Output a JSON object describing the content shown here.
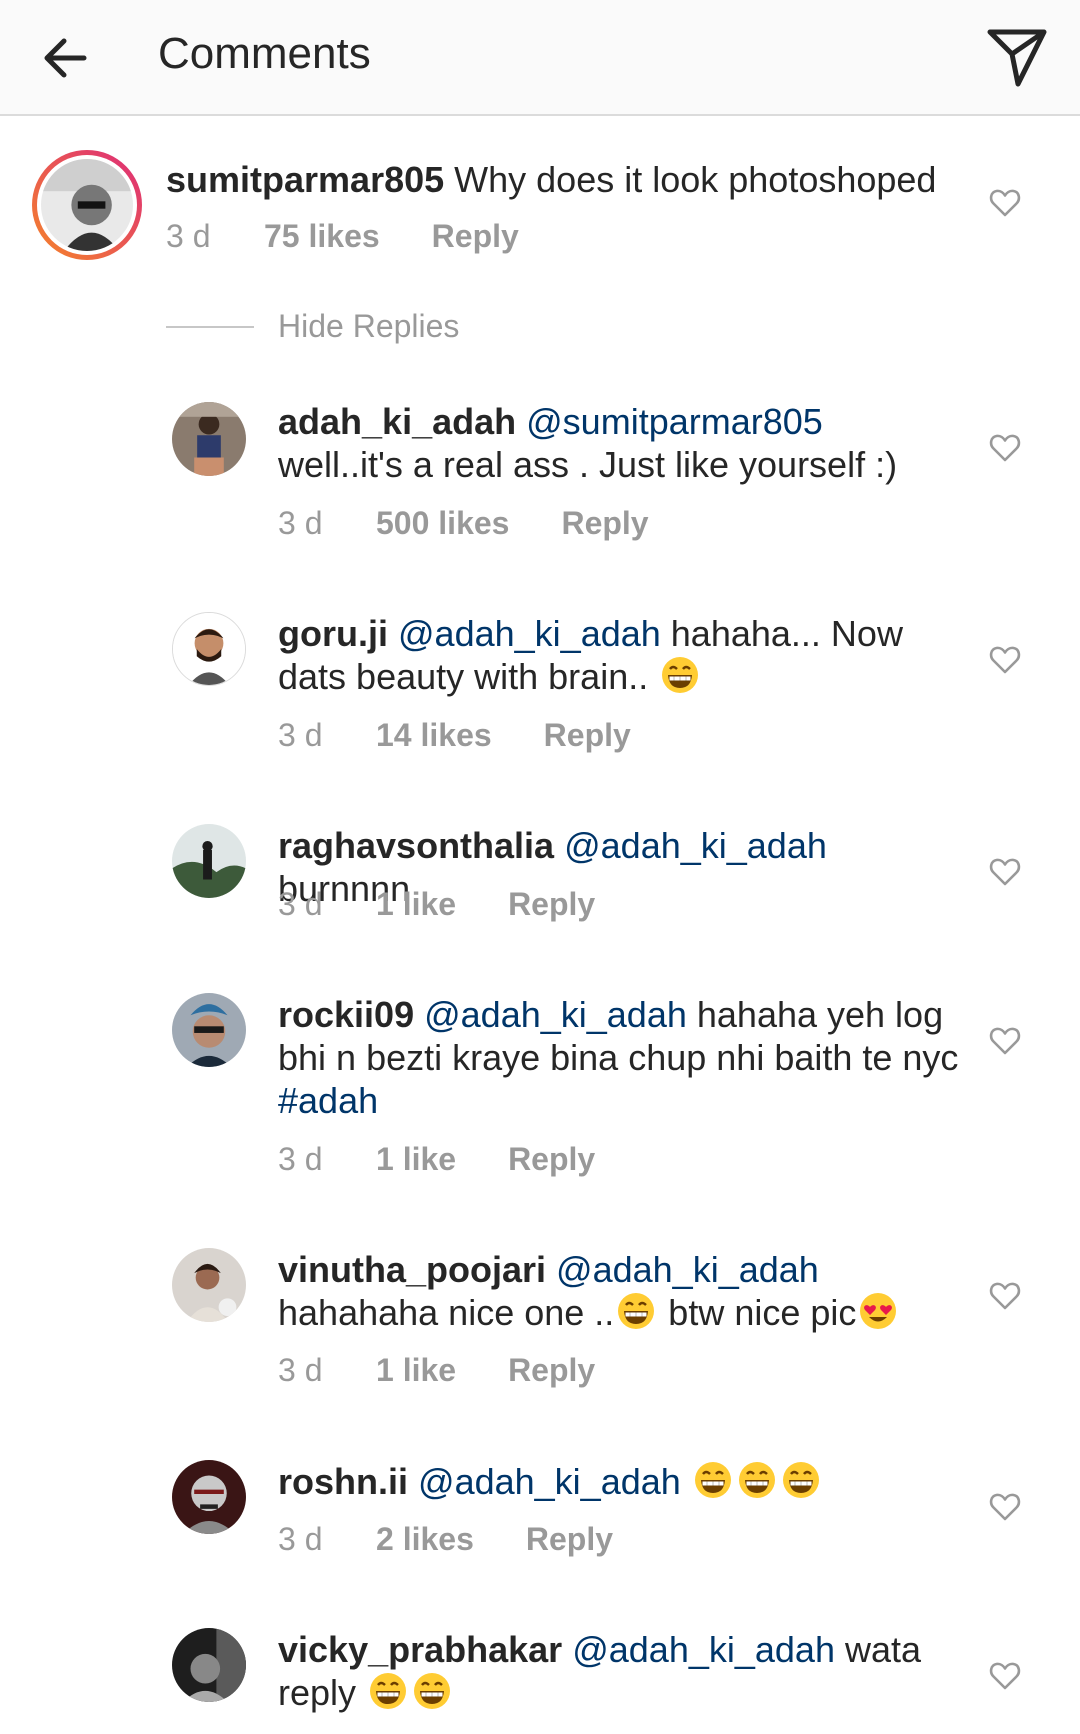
{
  "header": {
    "title": "Comments",
    "back_icon": "arrow-left-icon",
    "share_icon": "paper-plane-icon"
  },
  "main_comment": {
    "username": "sumitparmar805",
    "text": " Why does it look photoshoped",
    "time": "3 d",
    "likes": "75 likes",
    "reply": "Reply"
  },
  "hide_replies": "Hide Replies",
  "replies": [
    {
      "username": "adah_ki_adah",
      "mention": "@sumitparmar805",
      "text": "well..it's a real ass . Just like yourself :)",
      "time": "3 d",
      "likes": "500 likes",
      "reply": "Reply"
    },
    {
      "username": "goru.ji",
      "mention": "@adah_ki_adah",
      "text": " hahaha... Now dats beauty with brain.. ",
      "time": "3 d",
      "likes": "14 likes",
      "reply": "Reply"
    },
    {
      "username": "raghavsonthalia",
      "mention": "@adah_ki_adah",
      "text": " burnnnn",
      "time": "3 d",
      "likes": "1 like",
      "reply": "Reply"
    },
    {
      "username": "rockii09",
      "mention": "@adah_ki_adah",
      "text": " hahaha yeh log bhi n bezti kraye bina chup nhi baith te nyc ",
      "hashtag": "#adah",
      "time": "3 d",
      "likes": "1 like",
      "reply": "Reply"
    },
    {
      "username": "vinutha_poojari",
      "mention": "@adah_ki_adah",
      "text1": "hahahaha nice one ..",
      "text2": " btw nice pic",
      "time": "3 d",
      "likes": "1 like",
      "reply": "Reply"
    },
    {
      "username": "roshn.ii",
      "mention": "@adah_ki_adah",
      "text": " ",
      "time": "3 d",
      "likes": "2 likes",
      "reply": "Reply"
    },
    {
      "username": "vicky_prabhakar",
      "mention": "@adah_ki_adah",
      "text": " wata reply ",
      "time": "",
      "likes": "",
      "reply": ""
    }
  ],
  "colors": {
    "mention": "#003569",
    "meta": "#999999",
    "story_ring_start": "#f58529",
    "story_ring_end": "#dd2a7b"
  },
  "emoji": "grinning-squinting-face, smiling-face-with-heart-eyes"
}
